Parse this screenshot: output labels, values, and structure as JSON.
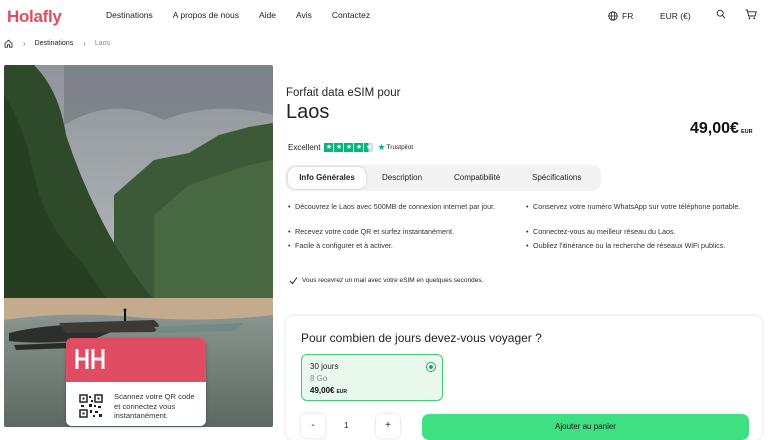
{
  "brand": {
    "name": "Holafly",
    "accent": "#e34b5e"
  },
  "nav": {
    "links": [
      "Destinations",
      "A propos de nous",
      "Aide",
      "Avis",
      "Contactez"
    ],
    "language": "FR",
    "currency": "EUR (€)",
    "icons": [
      "globe-icon",
      "search-icon",
      "cart-icon"
    ]
  },
  "breadcrumb": {
    "home_icon": "home-icon",
    "items": [
      "Destinations",
      "Laos"
    ]
  },
  "product": {
    "subtitle": "Forfait data eSIM pour",
    "title": "Laos",
    "price": "49,00€",
    "price_currency": "EUR",
    "rating_label": "Excellent",
    "rating_stars": 4.5,
    "rating_brand": "Trustpilot"
  },
  "tabs": [
    "Info Générales",
    "Description",
    "Compatibilité",
    "Spécifications"
  ],
  "active_tab": "Info Générales",
  "features": {
    "left": [
      "Découvrez le Laos avec 500MB de connexion internet par jour.",
      "Recevez votre code QR et surfez instantanément.",
      "Facile à configurer et à activer."
    ],
    "right": [
      "Conservez votre numéro WhatsApp sur votre téléphone portable.",
      "Connectez-vous au meilleur réseau du Laos.",
      "Oubliez l'itinérance ou la recherche de réseaux WiFi publics."
    ]
  },
  "mail_note": "Vous recevrez un mail avec votre eSIM en quelques secondes.",
  "card": {
    "text": "Scannez votre QR code et connectez vous instantanément.",
    "color": "#e04c61"
  },
  "order": {
    "question": "Pour combien de jours devez-vous voyager ?",
    "plan": {
      "days": "30 jours",
      "data": "8 Go",
      "price": "49,00€",
      "currency": "EUR",
      "selected": true
    },
    "quantity_minus": "-",
    "quantity": "1",
    "quantity_plus": "+",
    "add_to_cart": "Ajouter au panier",
    "cta_color": "#3ee082"
  }
}
